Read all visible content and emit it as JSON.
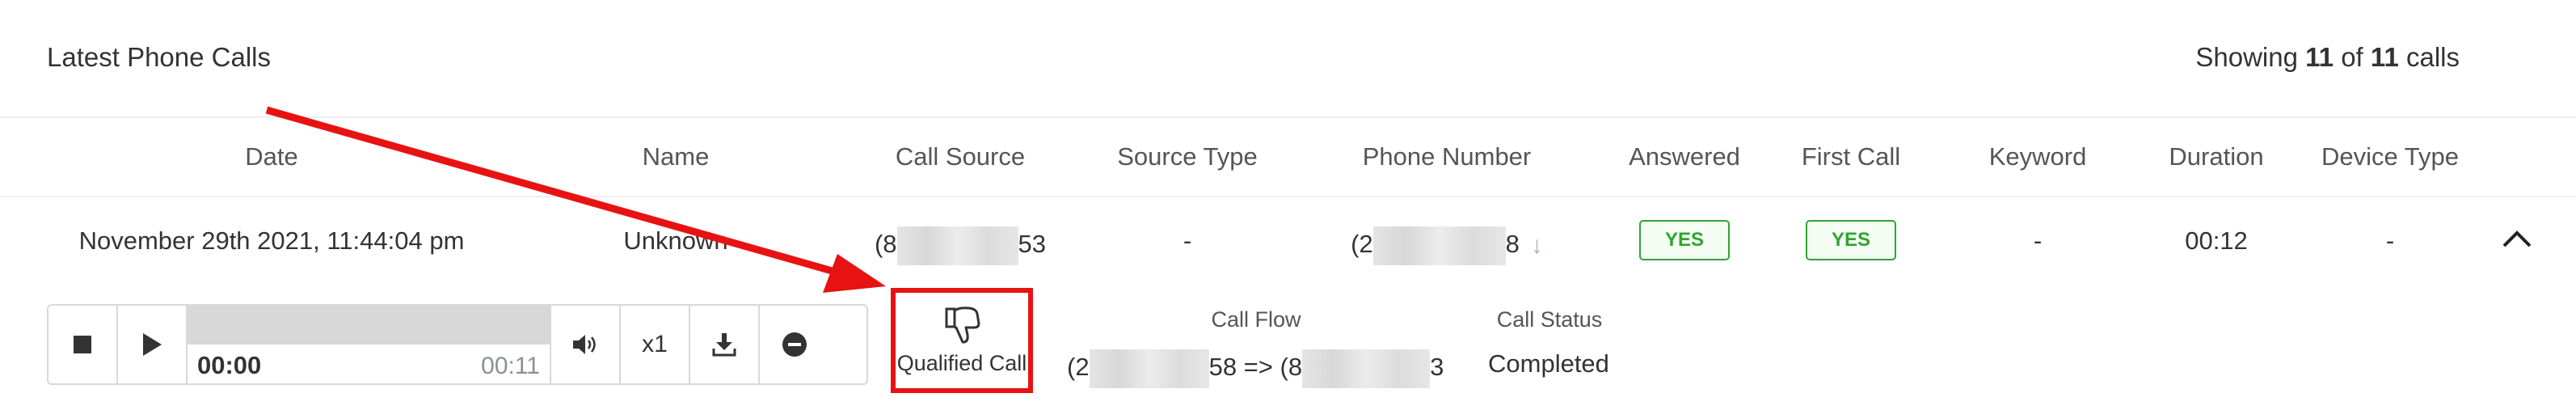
{
  "header": {
    "title": "Latest Phone Calls",
    "showing_prefix": "Showing",
    "showing_count": "11",
    "showing_of": "of",
    "showing_total": "11",
    "showing_suffix": "calls"
  },
  "columns": [
    "Date",
    "Name",
    "Call Source",
    "Source Type",
    "Phone Number",
    "Answered",
    "First Call",
    "Keyword",
    "Duration",
    "Device Type"
  ],
  "row": {
    "date": "November 29th 2021, 11:44:04 pm",
    "name": "Unknown",
    "call_source_prefix": "(8",
    "call_source_suffix": "53",
    "source_type": "-",
    "phone_prefix": "(2",
    "phone_suffix": "8",
    "answered": "YES",
    "first_call": "YES",
    "keyword": "-",
    "duration": "00:12",
    "device_type": "-"
  },
  "player": {
    "current": "00:00",
    "total": "00:11",
    "speed": "x1",
    "progress": 0
  },
  "qualified": {
    "label": "Qualified Call"
  },
  "details": {
    "call_flow_label": "Call Flow",
    "call_flow_a_prefix": "(2",
    "call_flow_a_suffix": "58 => (8",
    "call_flow_b_suffix": "3",
    "call_status_label": "Call Status",
    "call_status": "Completed"
  },
  "colors": {
    "accent_green": "#2fa52f",
    "highlight_red": "#e81212"
  }
}
